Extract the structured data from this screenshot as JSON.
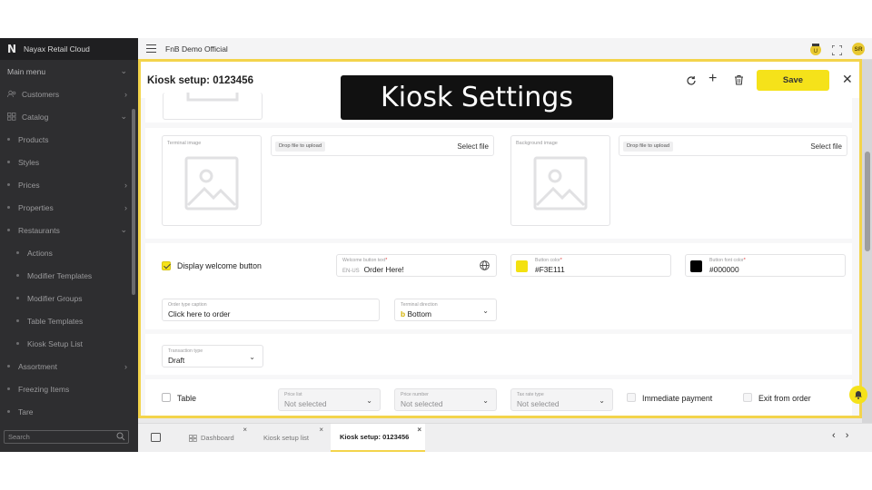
{
  "sidebar": {
    "logo": "N",
    "brand": "Nayax Retail Cloud",
    "items": [
      {
        "label": "Main menu",
        "chevron": "⌄",
        "level": 0
      },
      {
        "label": "Customers",
        "chevron": "›",
        "level": 1,
        "icon": "users-icon"
      },
      {
        "label": "Catalog",
        "chevron": "⌄",
        "level": 1,
        "icon": "grid-icon"
      },
      {
        "label": "Products",
        "chevron": "",
        "level": 2
      },
      {
        "label": "Styles",
        "chevron": "",
        "level": 2
      },
      {
        "label": "Prices",
        "chevron": "›",
        "level": 2
      },
      {
        "label": "Properties",
        "chevron": "›",
        "level": 2
      },
      {
        "label": "Restaurants",
        "chevron": "⌄",
        "level": 2
      },
      {
        "label": "Actions",
        "chevron": "",
        "level": 3
      },
      {
        "label": "Modifier Templates",
        "chevron": "",
        "level": 3
      },
      {
        "label": "Modifier Groups",
        "chevron": "",
        "level": 3
      },
      {
        "label": "Table Templates",
        "chevron": "",
        "level": 3
      },
      {
        "label": "Kiosk Setup List",
        "chevron": "",
        "level": 3
      },
      {
        "label": "Assortment",
        "chevron": "›",
        "level": 2
      },
      {
        "label": "Freezing Items",
        "chevron": "",
        "level": 2
      },
      {
        "label": "Tare",
        "chevron": "",
        "level": 2
      }
    ],
    "search_placeholder": "Search"
  },
  "topbar": {
    "org_name": "FnB Demo Official",
    "avatar_initials": "SR"
  },
  "dialog": {
    "title": "Kiosk setup: 0123456",
    "save_label": "Save",
    "images": [
      {
        "caption": "Terminal image",
        "drop_label": "Drop file to upload",
        "select_label": "Select file"
      },
      {
        "caption": "Background image",
        "drop_label": "Drop file to upload",
        "select_label": "Select file"
      }
    ],
    "welcome": {
      "checkbox_label": "Display welcome button",
      "checked": true,
      "button_text_label": "Welcome button text",
      "lang_code": "EN-US",
      "button_text_value": "Order Here!",
      "button_color_label": "Button color",
      "button_color_value": "#F3E111",
      "button_color_hex": "#F3E111",
      "font_color_label": "Button font color",
      "font_color_value": "#000000",
      "font_color_hex": "#000000"
    },
    "order_type": {
      "label": "Order type caption",
      "value": "Click here to order"
    },
    "terminal_direction": {
      "label": "Terminal direction",
      "prefix": "b",
      "value": "Bottom"
    },
    "transaction_type": {
      "label": "Transaction type",
      "value": "Draft"
    },
    "table_row": {
      "checkbox_label": "Table",
      "price_list_label": "Price list",
      "price_list_value": "Not selected",
      "price_number_label": "Price number",
      "price_number_value": "Not selected",
      "tax_rate_label": "Tax rate type",
      "tax_rate_value": "Not selected",
      "immediate_payment_label": "Immediate payment",
      "exit_order_label": "Exit from order"
    }
  },
  "banner": {
    "text": "Kiosk Settings"
  },
  "tabs": [
    {
      "label": "Dashboard",
      "active": false
    },
    {
      "label": "Kiosk setup list",
      "active": false
    },
    {
      "label": "Kiosk setup: 0123456",
      "active": true
    }
  ],
  "colors": {
    "accent_yellow": "#F5E21A",
    "dialog_border": "#F3D44B",
    "sidebar_bg": "#2E2E30"
  }
}
